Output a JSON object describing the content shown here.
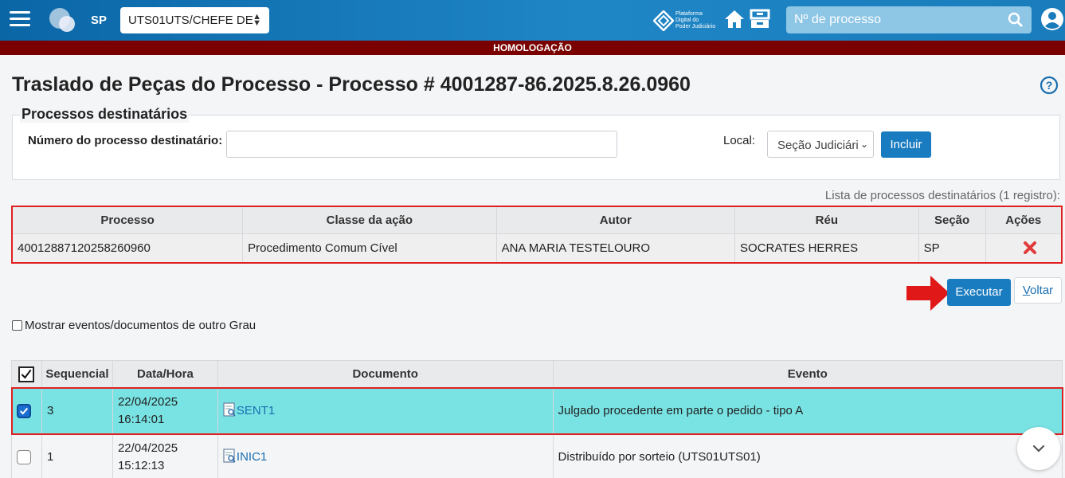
{
  "header": {
    "uf": "SP",
    "unit_select": "UTS01UTS/CHEFE DE",
    "platform_text_1": "Plataforma",
    "platform_text_2": "Digital do",
    "platform_text_3": "Poder Judiciário",
    "search_placeholder": "Nº de processo"
  },
  "environment_banner": "HOMOLOGAÇÃO",
  "page_title": "Traslado de Peças do Processo - Processo # 4001287-86.2025.8.26.0960",
  "dest_form": {
    "legend": "Processos destinatários",
    "number_label": "Número do processo destinatário:",
    "number_value": "",
    "local_label": "Local:",
    "local_selected": "Seção Judiciária",
    "include_button": "Incluir"
  },
  "dest_list_caption": "Lista de processos destinatários (1 registro):",
  "dest_table": {
    "headers": [
      "Processo",
      "Classe da ação",
      "Autor",
      "Réu",
      "Seção",
      "Ações"
    ],
    "rows": [
      {
        "processo": "40012887120258260960",
        "classe": "Procedimento Comum Cível",
        "autor": "ANA MARIA TESTELOURO",
        "reu": "SOCRATES HERRES",
        "secao": "SP"
      }
    ]
  },
  "actions": {
    "execute_button": "Executar",
    "back_button_first": "V",
    "back_button_rest": "oltar"
  },
  "show_other_grade_label": "Mostrar eventos/documentos de outro Grau",
  "docs_table": {
    "headers": [
      "Sequencial",
      "Data/Hora",
      "Documento",
      "Evento"
    ],
    "rows": [
      {
        "seq": "3",
        "date": "22/04/2025",
        "time": "16:14:01",
        "doc": "SENT1",
        "event": "Julgado procedente em parte o pedido - tipo A",
        "checked": true
      },
      {
        "seq": "1",
        "date": "22/04/2025",
        "time": "15:12:13",
        "doc": "INIC1",
        "event": "Distribuído por sorteio (UTS01UTS01)",
        "checked": false
      }
    ]
  },
  "colors": {
    "header_blue": "#0b66a6",
    "env_bar": "#7a0000",
    "primary_button": "#1a7cc0",
    "selected_row": "#79e3e4",
    "highlight_red": "#e02020"
  }
}
